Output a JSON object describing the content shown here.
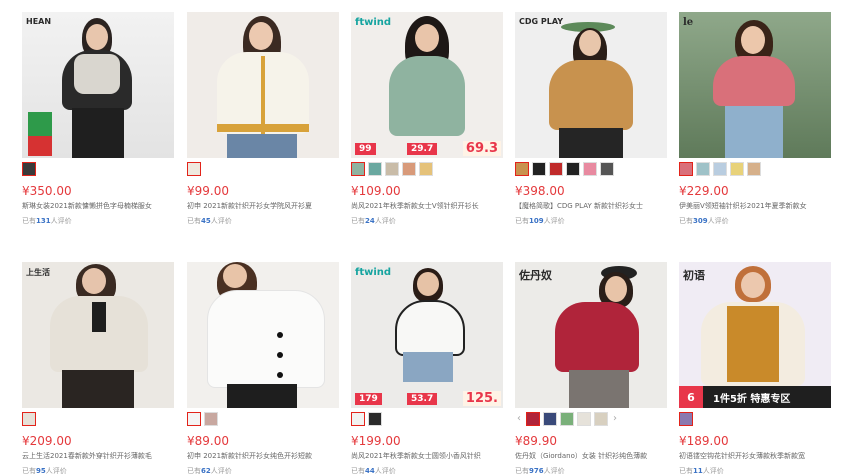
{
  "products": [
    {
      "logo": "HEAN",
      "price": "¥350.00",
      "title": "斯琳女装2021新款慵懒拼色字母楠梯服女",
      "reviews_prefix": "已有",
      "reviews_count": "131",
      "reviews_suffix": "人评价"
    },
    {
      "logo": "",
      "price": "¥99.00",
      "title": "初申 2021新款针织开衫女学院风开衫夏",
      "reviews_prefix": "已有",
      "reviews_count": "45",
      "reviews_suffix": "人评价"
    },
    {
      "logo": "ftwind",
      "price": "¥109.00",
      "title": "尚风2021年秋季新款女士V领针织开衫长",
      "reviews_prefix": "已有",
      "reviews_count": "24",
      "reviews_suffix": "人评价",
      "promo": {
        "a": "99",
        "b": "29.7",
        "c": "69.3"
      }
    },
    {
      "logo": "CDG PLAY",
      "price": "¥398.00",
      "title": "【魔格简歌】CDG PLAY 新款针织衫女士",
      "reviews_prefix": "已有",
      "reviews_count": "109",
      "reviews_suffix": "人评价"
    },
    {
      "logo": "le",
      "price": "¥229.00",
      "title": "伊美丽V领短袖针织衫2021年夏季新款女",
      "reviews_prefix": "已有",
      "reviews_count": "309",
      "reviews_suffix": "人评价"
    },
    {
      "logo": "上生活",
      "price": "¥209.00",
      "title": "云上生活2021春新款外穿针织开衫薄款毛",
      "reviews_prefix": "已有",
      "reviews_count": "95",
      "reviews_suffix": "人评价"
    },
    {
      "logo": "",
      "price": "¥89.00",
      "title": "初申 2021新款针织开衫女纯色开衫短款",
      "reviews_prefix": "已有",
      "reviews_count": "62",
      "reviews_suffix": "人评价"
    },
    {
      "logo": "ftwind",
      "price": "¥199.00",
      "title": "尚风2021年秋季新款女士圆领小香风针织",
      "reviews_prefix": "已有",
      "reviews_count": "44",
      "reviews_suffix": "人评价",
      "promo": {
        "a": "179",
        "b": "53.7",
        "c": "125."
      }
    },
    {
      "logo": "佐丹奴",
      "price": "¥89.90",
      "title": "佐丹奴（Giordano）女装 针织衫纯色薄款",
      "reviews_prefix": "已有",
      "reviews_count": "976",
      "reviews_suffix": "人评价"
    },
    {
      "logo": "初语",
      "price": "¥189.00",
      "title": "初语镂空钩花针织开衫女薄款秋季新款宽",
      "reviews_prefix": "已有",
      "reviews_count": "11",
      "reviews_suffix": "人评价",
      "special": {
        "num": "6",
        "text": "1件5折 特惠专区"
      }
    }
  ],
  "colors": {
    "price": "#e4393c",
    "count": "#3a72c5",
    "active_border": "#e2231a"
  }
}
